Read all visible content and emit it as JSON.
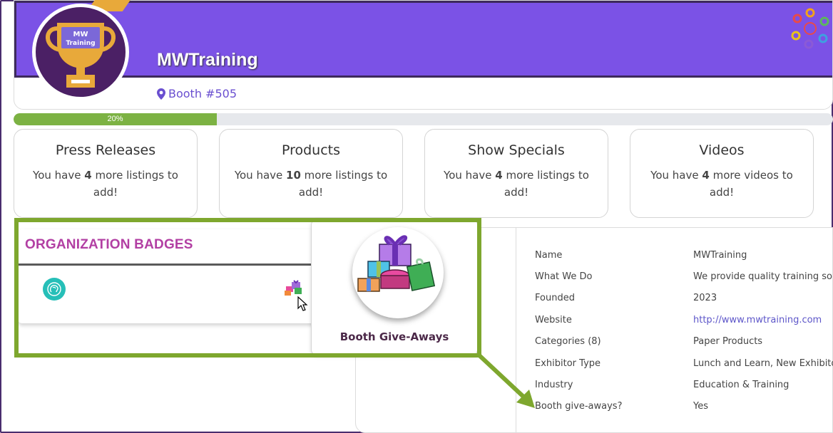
{
  "profile": {
    "company_name": "MWTraining",
    "logo_text_line1": "MW",
    "logo_text_line2": "Training",
    "booth": "Booth #505"
  },
  "progress": {
    "percent": 20,
    "label": "20%"
  },
  "stats": [
    {
      "title": "Press Releases",
      "prefix": "You have ",
      "count": "4",
      "suffix": " more listings to add!"
    },
    {
      "title": "Products",
      "prefix": "You have ",
      "count": "10",
      "suffix": " more listings to add!"
    },
    {
      "title": "Show Specials",
      "prefix": "You have ",
      "count": "4",
      "suffix": " more listings to add!"
    },
    {
      "title": "Videos",
      "prefix": "You have ",
      "count": "4",
      "suffix": " more videos to add!"
    }
  ],
  "badges": {
    "title": "ORGANIZATION BADGES",
    "items": [
      {
        "icon": "brain-icon",
        "color": "#26bfb8"
      },
      {
        "icon": "gift-icon"
      }
    ]
  },
  "tooltip": {
    "label": "Booth Give-Aways"
  },
  "details": {
    "rows": [
      {
        "label": "Name",
        "value": "MWTraining"
      },
      {
        "label": "What We Do",
        "value": "We provide quality training soluti"
      },
      {
        "label": "Founded",
        "value": "2023"
      },
      {
        "label": "Website",
        "value": "http://www.mwtraining.com"
      },
      {
        "label": "Categories (8)",
        "value": "Paper Products"
      },
      {
        "label": "Exhibitor Type",
        "value": "Lunch and Learn, New Exhibitor"
      },
      {
        "label": "Industry",
        "value": "Education & Training"
      },
      {
        "label": "Booth give-aways?",
        "value": "Yes"
      }
    ]
  },
  "colors": {
    "banner": "#7b52e6",
    "accent_green": "#7cb243",
    "badge_title": "#b23fa3",
    "highlight": "#7ea72e",
    "link": "#5d56c9"
  }
}
